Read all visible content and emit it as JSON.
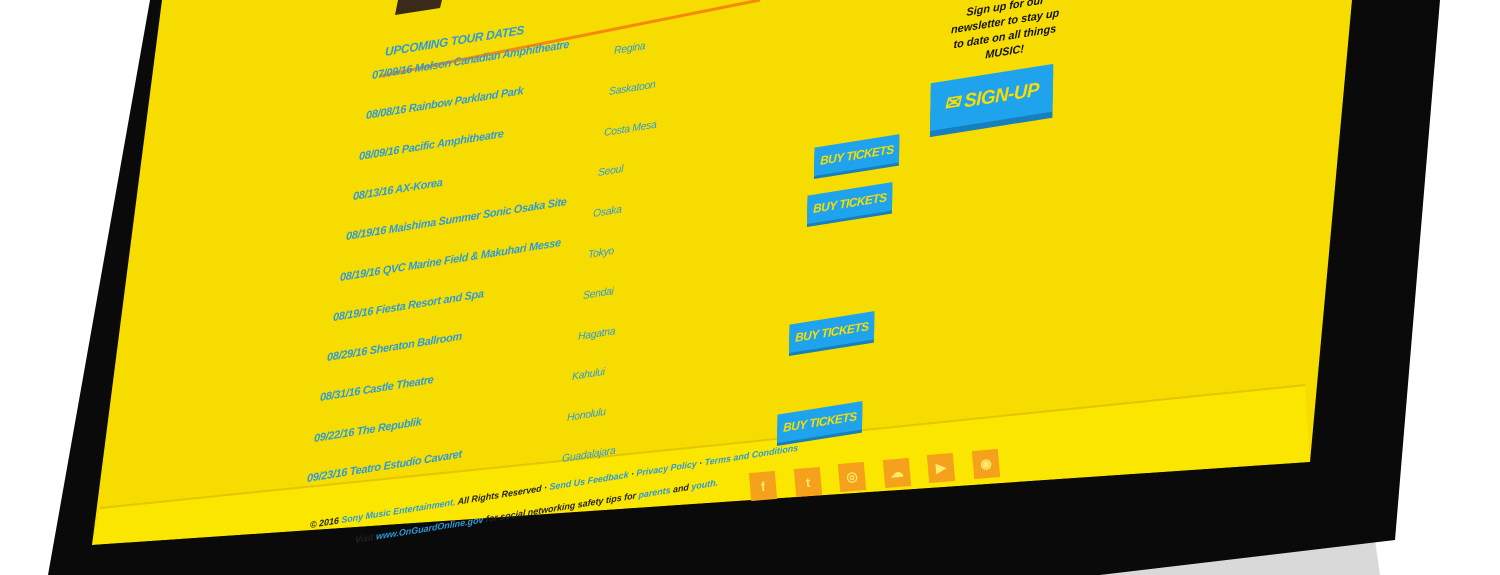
{
  "tour": {
    "heading": "UPCOMING TOUR DATES",
    "dates": [
      "07/09/16  Molson Canadian Amphitheatre",
      "08/08/16  Rainbow Parkland Park",
      "08/09/16  Pacific Amphitheatre",
      "08/13/16  AX-Korea",
      "08/19/16  Maishima Summer Sonic Osaka Site",
      "08/19/16  QVC Marine Field & Makuhari Messe",
      "08/19/16  Fiesta Resort and Spa",
      "08/29/16  Sheraton Ballroom",
      "08/31/16  Castle Theatre",
      "09/22/16  The Republik",
      "09/23/16  Teatro Estudio Cavaret"
    ],
    "venues": [
      "Regina",
      "Saskatoon",
      "Costa Mesa",
      "Seoul",
      "Osaka",
      "Tokyo",
      "Sendai",
      "Hagatna",
      "Kahului",
      "Honolulu",
      "Guadalajara"
    ],
    "buy_tickets_label": "BUY TICKETS"
  },
  "newsletter": {
    "lines": [
      "Sign up for our",
      "newsletter to stay up",
      "to date on all things",
      "MUSIC!"
    ],
    "signup_label": "SIGN-UP",
    "signup_icon": "envelope-icon"
  },
  "social": [
    {
      "name": "facebook",
      "glyph": "f"
    },
    {
      "name": "twitter",
      "glyph": "t"
    },
    {
      "name": "instagram",
      "glyph": "◎"
    },
    {
      "name": "soundcloud",
      "glyph": "☁"
    },
    {
      "name": "youtube",
      "glyph": "▶"
    },
    {
      "name": "spotify",
      "glyph": "◉"
    }
  ],
  "footer": {
    "copyright_prefix": "© 2016",
    "company_link": "Sony Music Entertainment.",
    "rights": "All Rights Reserved ·",
    "feedback": "Send Us Feedback",
    "privacy": "Privacy Policy",
    "terms": "Terms and Conditions",
    "visit": "Visit",
    "site_link": "www.OnGuardOnline.gov",
    "safety_text": "for social networking safety tips for",
    "parents": "parents",
    "and": "and",
    "youth": "youth."
  },
  "colors": {
    "yellow": "#f7dc00",
    "footer_yellow": "#fbe600",
    "blue": "#2a9bdc",
    "orange": "#f6a11c",
    "bezel": "#0a0a0a"
  }
}
